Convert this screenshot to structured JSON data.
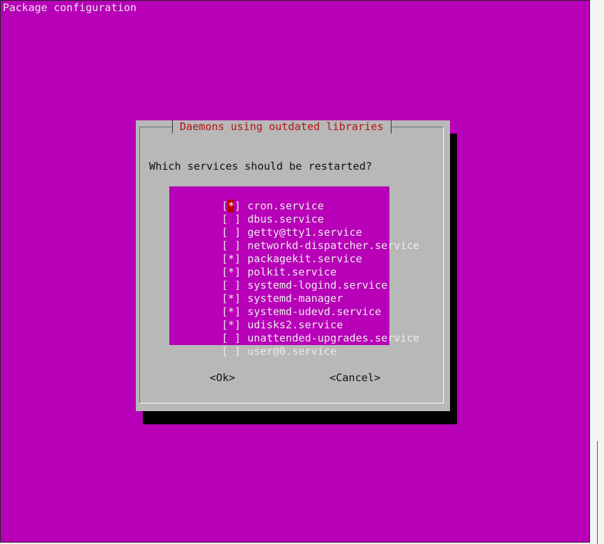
{
  "header": {
    "title": "Package configuration"
  },
  "dialog": {
    "title": "Daemons using outdated libraries",
    "prompt": "Which services should be restarted?",
    "items": [
      {
        "checked": true,
        "mark": "[*]",
        "label": "cron.service"
      },
      {
        "checked": false,
        "mark": "[ ]",
        "label": "dbus.service"
      },
      {
        "checked": false,
        "mark": "[ ]",
        "label": "getty@tty1.service"
      },
      {
        "checked": false,
        "mark": "[ ]",
        "label": "networkd-dispatcher.service"
      },
      {
        "checked": true,
        "mark": "[*]",
        "label": "packagekit.service"
      },
      {
        "checked": true,
        "mark": "[*]",
        "label": "polkit.service"
      },
      {
        "checked": false,
        "mark": "[ ]",
        "label": "systemd-logind.service"
      },
      {
        "checked": true,
        "mark": "[*]",
        "label": "systemd-manager"
      },
      {
        "checked": true,
        "mark": "[*]",
        "label": "systemd-udevd.service"
      },
      {
        "checked": true,
        "mark": "[*]",
        "label": "udisks2.service"
      },
      {
        "checked": false,
        "mark": "[ ]",
        "label": "unattended-upgrades.service"
      },
      {
        "checked": false,
        "mark": "[ ]",
        "label": "user@0.service"
      }
    ],
    "ok_label": "<Ok>",
    "cancel_label": "<Cancel>"
  },
  "colors": {
    "background": "#b700b7",
    "dialog": "#b8b8b8",
    "title": "#b31212",
    "cursor": "#b80000"
  }
}
